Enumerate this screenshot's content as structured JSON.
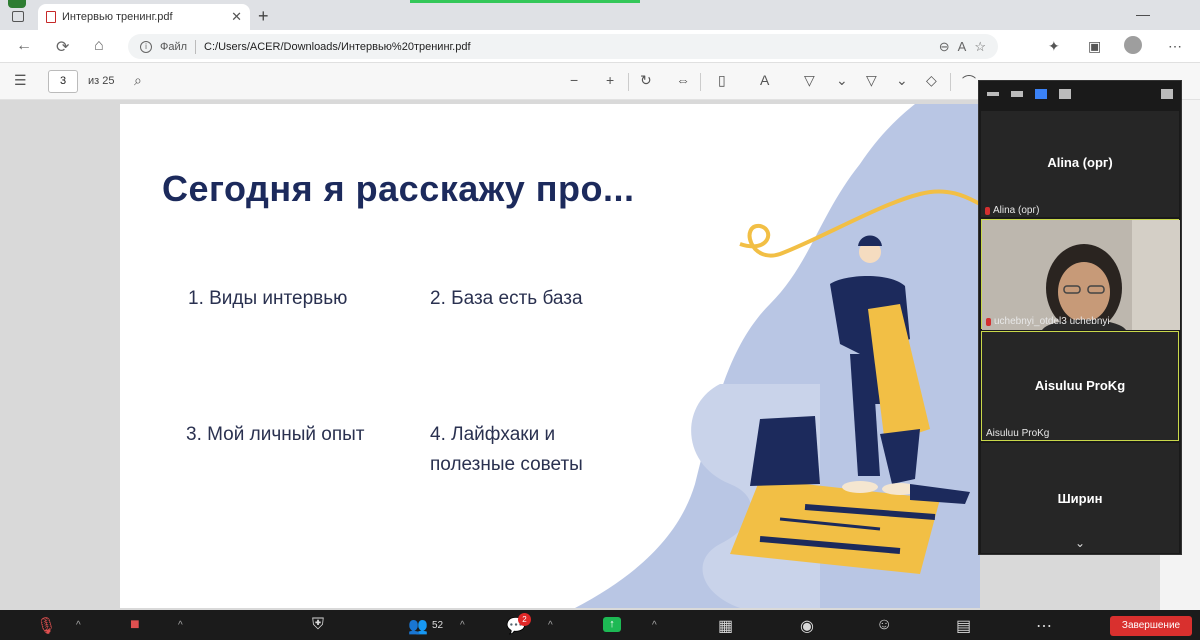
{
  "browser": {
    "tab_title": "Интервью тренинг.pdf",
    "scheme_label": "Файл",
    "url": "C:/Users/ACER/Downloads/Интервью%20тренинг.pdf"
  },
  "pdf_toolbar": {
    "page": "3",
    "page_count": "из 25"
  },
  "slide": {
    "title": "Сегодня я расскажу про...",
    "items": [
      "1. Виды интервью",
      "2. База есть база",
      "3. Мой личный опыт",
      "4. Лайфхаки и полезные советы"
    ]
  },
  "participants": [
    {
      "name": "Alina (орг)",
      "label": "Alina (орг)"
    },
    {
      "name": "",
      "label": "uchebnyi_otdel3 uchebnyi"
    },
    {
      "name": "Aisuluu ProKg",
      "label": "Aisuluu ProKg"
    },
    {
      "name": "Ширин",
      "label": ""
    }
  ],
  "zoom_toolbar": {
    "participants_count": "52",
    "chat_badge": "2",
    "end_label": "Завершение"
  },
  "colors": {
    "navy": "#1c2a5c",
    "accent_yellow": "#f2bf45",
    "illustration_blue": "#b9c6e4",
    "end_red": "#d9302e",
    "share_green": "#1db954"
  }
}
